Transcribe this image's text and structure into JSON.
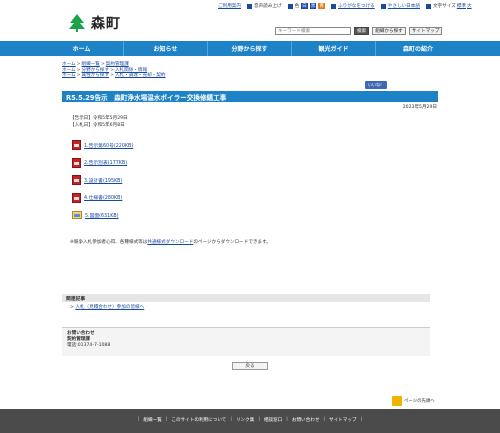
{
  "header": {
    "site_name": "森町",
    "util": {
      "help": "ご利用案内",
      "voice": "音声読み上げ",
      "color": "色",
      "furigana": "ふりがなをつける",
      "yasashii": "やさしい日本語",
      "font_size": "文字サイズ",
      "font_std": "標準",
      "font_big": "大"
    },
    "search_placeholder": "キーワード検索",
    "search_button": "検索",
    "org_search": "組織から探す",
    "sitemap": "サイトマップ"
  },
  "nav": [
    "ホーム",
    "お知らせ",
    "分野から探す",
    "観光ガイド",
    "森町の紹介"
  ],
  "breadcrumbs": [
    [
      "ホーム",
      "組織一覧",
      "契約管理課"
    ],
    [
      "ホーム",
      "分野から探す",
      "入札関係・情報"
    ],
    [
      "ホーム",
      "属性から探す",
      "入札・調達・売却・契約"
    ]
  ],
  "like_button": "いいね！",
  "title": "R5.5.29告示　森町浄水場温水ボイラー交換修繕工事",
  "date": "2023年5月29日",
  "meta": [
    "【告示日】令和5年5月29日",
    "【入札日】令和5年6月8日"
  ],
  "files": [
    {
      "label": "1.告示第60号(220KB)",
      "icon": "pdf-icon"
    },
    {
      "label": "2.告示別表(177KB)",
      "icon": "pdf-icon"
    },
    {
      "label": "3.設計書(195KB)",
      "icon": "pdf-icon"
    },
    {
      "label": "4.仕様書(280KB)",
      "icon": "pdf-icon"
    },
    {
      "label": "5.図面(631KB)",
      "icon": "image-icon"
    }
  ],
  "note": {
    "prefix": "※競争入札参加者心得、各種様式等は",
    "link": "共通様式ダウンロード",
    "suffix": "のページからダウンロードできます。"
  },
  "related": {
    "heading": "関連記事",
    "items": [
      "入札（見積合わせ）参加の皆様へ"
    ]
  },
  "contact": {
    "heading": "お問い合わせ",
    "dept": "契約管理課",
    "phone": "電話:01374-7-1088"
  },
  "back_button": "戻る",
  "page_top": "ページの先頭へ",
  "footer_links": [
    "組織一覧",
    "このサイトの利用について",
    "リンク集",
    "相談窓口",
    "お問い合わせ",
    "サイトマップ"
  ]
}
